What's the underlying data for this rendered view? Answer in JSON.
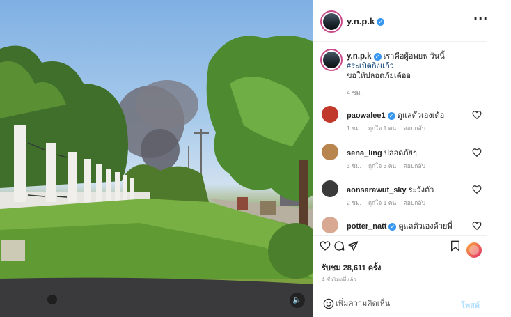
{
  "post": {
    "username": "y.n.p.k",
    "verified": true,
    "caption_parts": [
      "เราคือผู้อพยพ วันนี้",
      "#ระเบิดกิ่งแก้ว",
      "ขอให้ปลอดภัยเด้ออ"
    ],
    "caption_time": "4 ชม."
  },
  "comments": [
    {
      "user": "paowalee1",
      "verified": true,
      "text": "ดูแลตัวเองเด้อ",
      "time": "1 ชม.",
      "likes": "ถูกใจ 1 คน",
      "reply": "ตอบกลับ",
      "avatar_color": "#c0392b"
    },
    {
      "user": "sena_ling",
      "verified": false,
      "text": "ปลอดภัยๆ",
      "time": "3 ชม.",
      "likes": "ถูกใจ 3 คน",
      "reply": "ตอบกลับ",
      "avatar_color": "#b9854f"
    },
    {
      "user": "aonsarawut_sky",
      "verified": false,
      "text": "ระวังตัว",
      "time": "2 ชม.",
      "likes": "ถูกใจ 1 คน",
      "reply": "ตอบกลับ",
      "avatar_color": "#3a3a3a"
    },
    {
      "user": "potter_natt",
      "verified": true,
      "text": "ดูแลตัวเองด้วยพี่",
      "time": "",
      "likes": "",
      "reply": "",
      "avatar_color": "#d9a892"
    }
  ],
  "actions": {
    "likes_text": "รับชม 28,611 ครั้ง",
    "ago": "4 ชั่วโมงที่แล้ว",
    "add_comment_placeholder": "เพิ่มความคิดเห็น",
    "post_label": "โพสต์"
  },
  "icons": {
    "more": "more-options-icon",
    "like": "heart-icon",
    "comment": "comment-icon",
    "share": "share-icon",
    "save": "bookmark-icon",
    "emoji": "emoji-icon",
    "mute": "speaker-icon"
  },
  "colors": {
    "accent_blue": "#3897f0",
    "hashtag": "#00376b",
    "muted": "#8e8e8e",
    "post_button": "#b2dffc"
  }
}
